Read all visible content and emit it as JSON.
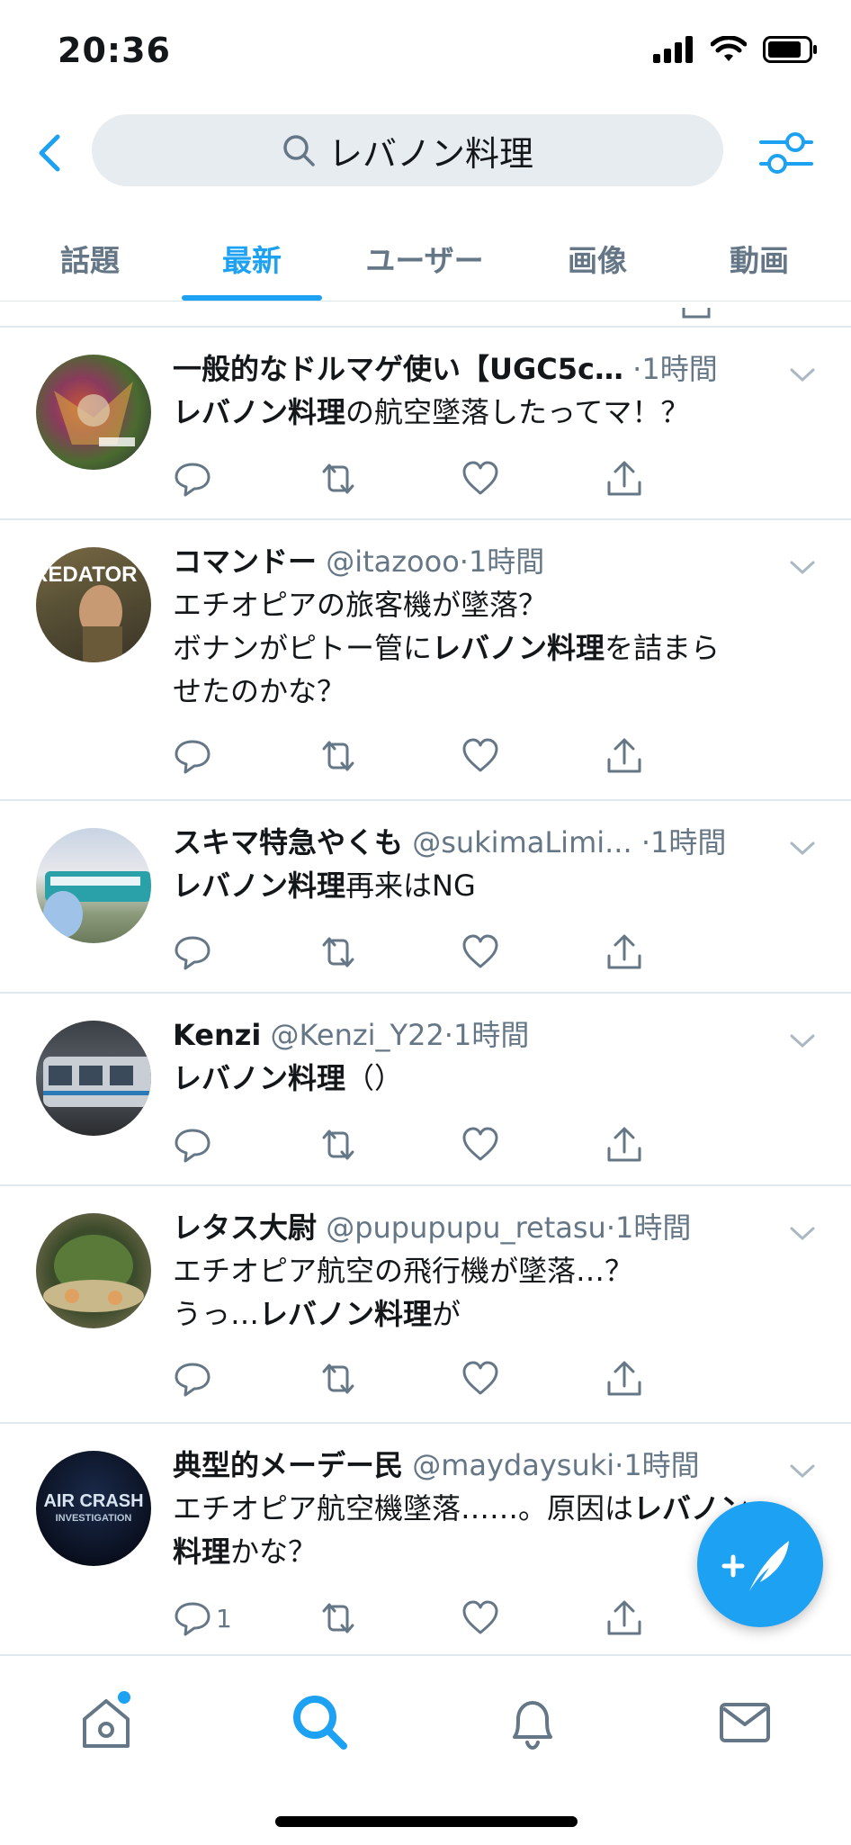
{
  "status": {
    "time": "20:36"
  },
  "search": {
    "query": "レバノン料理"
  },
  "tabs": [
    {
      "label": "話題"
    },
    {
      "label": "最新"
    },
    {
      "label": "ユーザー"
    },
    {
      "label": "画像"
    },
    {
      "label": "動画"
    }
  ],
  "active_tab": "最新",
  "tweets": [
    {
      "name": "一般的なドルマゲ使い【UGC5c…",
      "handle": "",
      "dot": "·",
      "time": "1時間",
      "body_bold": "レバノン料理",
      "body_rest": "の航空墜落したってマ！？",
      "avatar": "card-art"
    },
    {
      "name": "コマンドー",
      "handle": "@itazooo",
      "dot": "·",
      "time": "1時間",
      "line1": "エチオピアの旅客機が墜落？",
      "line2_pre": "ボナンがピトー管に",
      "body_bold": "レバノン料理",
      "line2_post": "を詰まら",
      "line3": "せたのかな？",
      "avatar_text": "REDATOR"
    },
    {
      "name": "スキマ特急やくも",
      "handle": "@sukimaLimi...",
      "dot": "·",
      "time": "1時間",
      "body_bold": "レバノン料理",
      "body_rest": "再来はNG",
      "avatar": "train-blue"
    },
    {
      "name": "Kenzi",
      "handle": "@Kenzi_Y22",
      "dot": "·",
      "time": "1時間",
      "body_bold": "レバノン料理",
      "body_rest": "（）",
      "avatar": "train-silver"
    },
    {
      "name": "レタス大尉",
      "handle": "@pupupupu_retasu",
      "dot": "·",
      "time": "1時間",
      "line1": "エチオピア航空の飛行機が墜落…？",
      "line2_pre": "うっ…",
      "body_bold": "レバノン料理",
      "line2_post": "が",
      "avatar": "salad"
    },
    {
      "name": "典型的メーデー民",
      "handle": "@maydaysuki",
      "dot": "·",
      "time": "1時間",
      "line1_pre": "エチオピア航空機墜落……。原因は",
      "line1_bold": "レバノン",
      "line2_bold": "料理",
      "line2_post": "かな？",
      "reply_count": "1",
      "avatar_text_1": "AIR CRASH",
      "avatar_text_2": "INVESTIGATION"
    }
  ],
  "colors": {
    "accent": "#1da1f2",
    "muted": "#657786",
    "divider": "#e1e8ed",
    "searchbg": "#e6ecf0"
  }
}
